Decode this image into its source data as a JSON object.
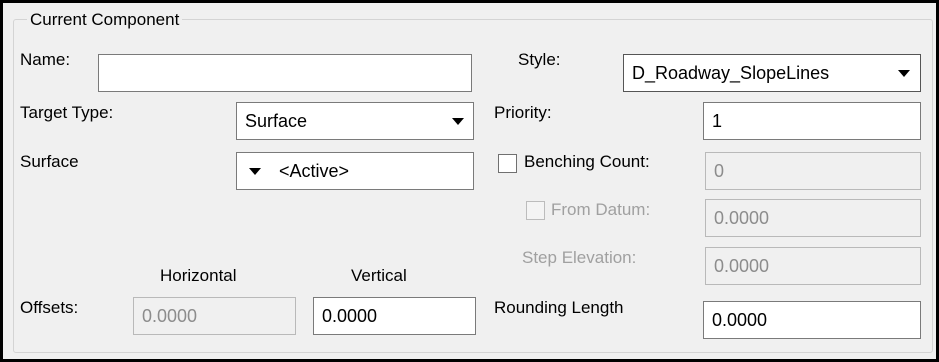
{
  "group_title": "Current Component",
  "name": {
    "label": "Name:",
    "value": ""
  },
  "style": {
    "label": "Style:",
    "value": "D_Roadway_SlopeLines"
  },
  "target_type": {
    "label": "Target Type:",
    "value": "Surface"
  },
  "priority": {
    "label": "Priority:",
    "value": "1"
  },
  "surface": {
    "label": "Surface",
    "value": "<Active>"
  },
  "benching_count": {
    "label": "Benching Count:",
    "value": "0",
    "checked": false
  },
  "from_datum": {
    "label": "From Datum:",
    "value": "0.0000",
    "checked": false
  },
  "step_elevation": {
    "label": "Step Elevation:",
    "value": "0.0000"
  },
  "offsets": {
    "label": "Offsets:",
    "horizontal_header": "Horizontal",
    "vertical_header": "Vertical",
    "horizontal_value": "0.0000",
    "vertical_value": "0.0000"
  },
  "rounding_length": {
    "label": "Rounding Length",
    "value": "0.0000"
  },
  "icons": {
    "dropdown": "triangle-down-icon",
    "checkbox": "checkbox-unchecked-icon"
  }
}
